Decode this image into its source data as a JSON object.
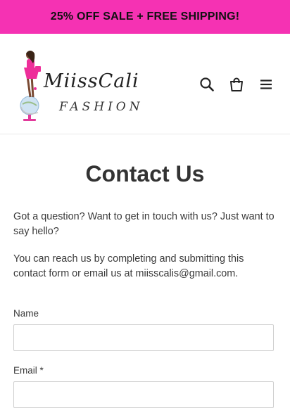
{
  "announcement": {
    "text": "25% OFF SALE + FREE SHIPPING!"
  },
  "header": {
    "logo": {
      "line1": "MiissCali",
      "line2": "FASHION"
    },
    "icons": [
      "search-icon",
      "cart-icon",
      "menu-icon"
    ]
  },
  "page": {
    "title": "Contact Us",
    "intro": "Got a question? Want to get in touch with us? Just want to say hello?",
    "reach": "You can reach us by completing and submitting this contact form or email us at miisscalis@gmail.com."
  },
  "form": {
    "name_label": "Name",
    "name_value": "",
    "email_label": "Email *",
    "email_value": ""
  },
  "colors": {
    "accent": "#f532b3"
  }
}
